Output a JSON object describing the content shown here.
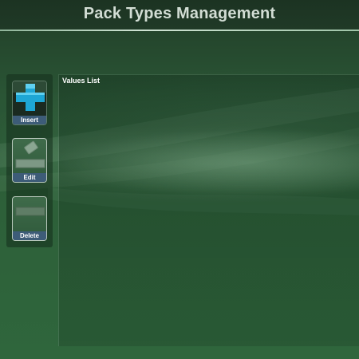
{
  "header": {
    "title": "Pack Types Management"
  },
  "toolbar": {
    "insert_label": "Insert",
    "edit_label": "Edit",
    "delete_label": "Delete"
  },
  "values_panel": {
    "title": "Values List"
  },
  "colors": {
    "background": "#2d6039",
    "title_text": "#d2ddd4",
    "button_label_bg": "#3d5c78",
    "insert_icon": "#1ea6d4"
  },
  "icons": {
    "insert": "plus-icon",
    "edit": "edit-icon",
    "delete": "delete-icon"
  }
}
